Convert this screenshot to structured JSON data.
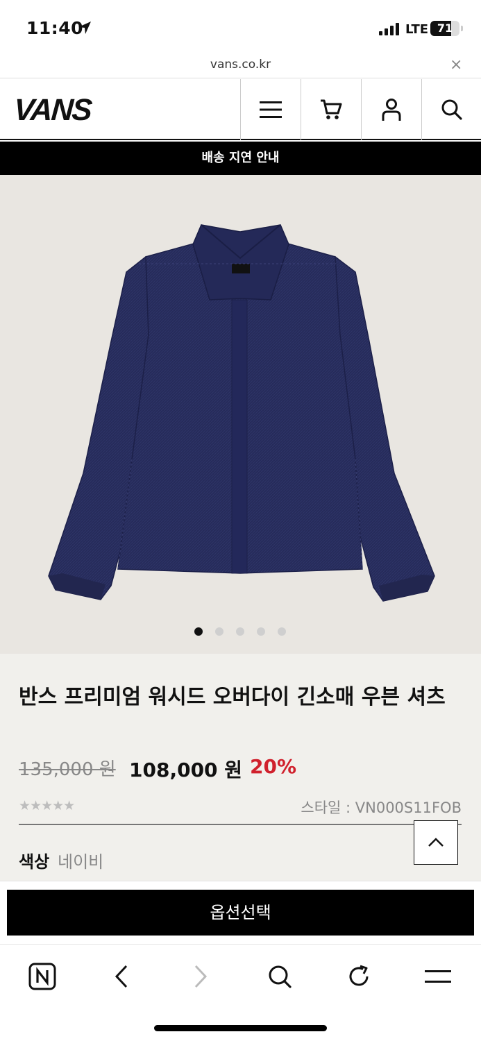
{
  "status_bar": {
    "time": "11:40",
    "network": "LTE",
    "battery": "71",
    "battery_level": 0.71
  },
  "browser": {
    "url": "vans.co.kr",
    "close_label": "×"
  },
  "header": {
    "logo": "VANS"
  },
  "notice": {
    "text": "배송 지연 안내"
  },
  "carousel": {
    "total_images": 5,
    "active_index": 0
  },
  "product": {
    "title": "반스 프리미엄 워시드 오버다이 긴소매 우븐 셔츠",
    "original_price": "135,000 원",
    "sale_price": "108,000 원",
    "discount": "20%",
    "rating_stars": "★★★★★",
    "style_code": "스타일 : VN000S11FOB",
    "color_label": "색상",
    "color_value": "네이비"
  },
  "option_button": {
    "label": "옵션선택"
  },
  "colors": {
    "brand": "#000000",
    "discount": "#d0202c",
    "hero_bg": "#e9e6e1",
    "info_bg": "#f1f0ec",
    "jacket": "#262b5a"
  }
}
